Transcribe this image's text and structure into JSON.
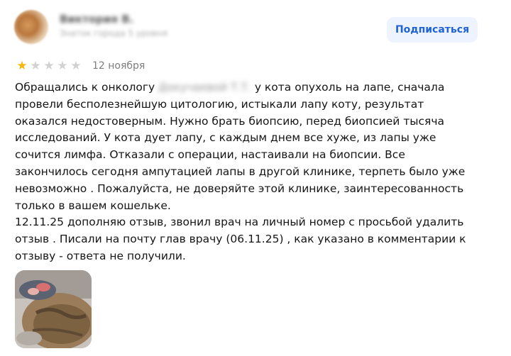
{
  "author": {
    "name": "Виктория В.",
    "subtitle": "Знаток города 5 уровня"
  },
  "subscribe_label": "Подписаться",
  "rating": {
    "value": 1,
    "max": 5,
    "filled_color": "#f4b80c",
    "empty_color": "#d2d2d2"
  },
  "date": "12 ноября",
  "review": {
    "part1": "Обращались к онкологу",
    "hidden_name": "Докучаевой Т.Т.",
    "part2": " у кота опухоль на лапе, сначала провели бесполезнейшую цитологию, истыкали лапу коту, результат оказался недостоверным. Нужно брать биопсию, перед биопсией тысяча исследований. У кота дует лапу, с каждым днем все хуже, из лапы уже сочится лимфа. Отказали с операции, настаивали на биопсии. Все закончилось сегодня ампутацией лапы в другой клинике, терпеть было уже невозможно . Пожалуйста, не доверяйте этой клинике, заинтересованность только в вашем кошельке.",
    "part3": "12.11.25 дополняю отзыв, звонил врач на личный номер с просьбой удалить отзыв . Писали на почту глав врачу (06.11.25) , как указано в комментарии к отзыву - ответа не получили."
  },
  "colors": {
    "accent": "#1f63d6",
    "button_bg": "#eef4ff"
  }
}
